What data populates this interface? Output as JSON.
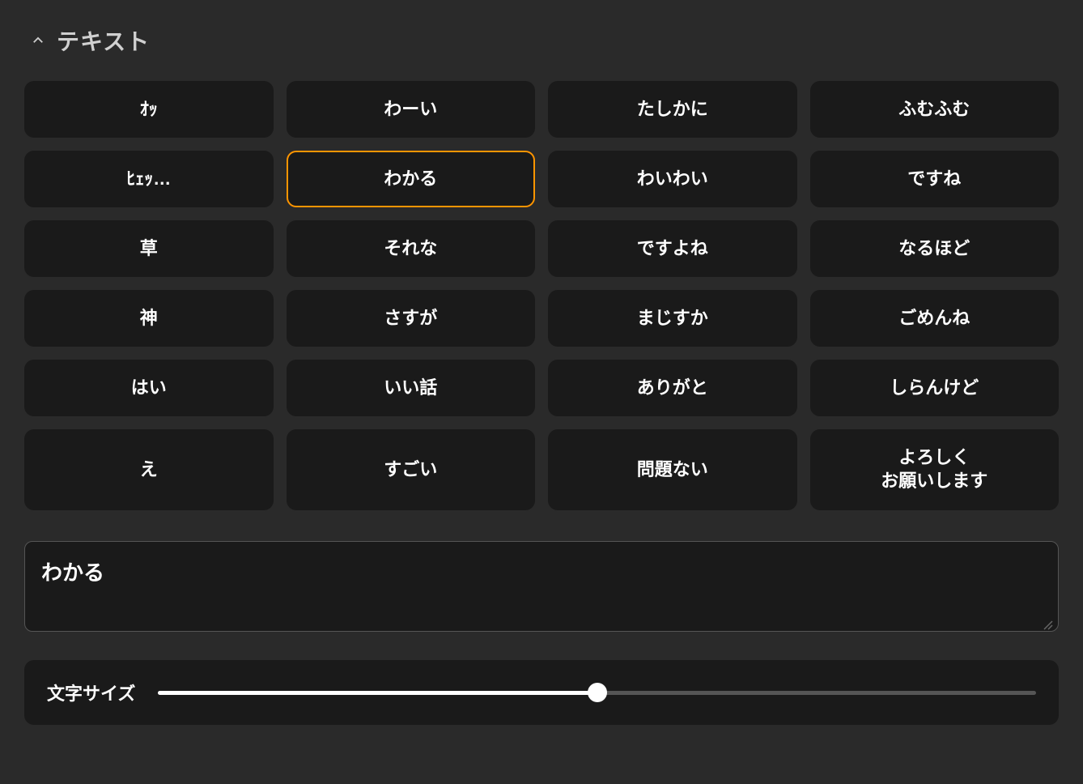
{
  "header": {
    "title": "テキスト"
  },
  "presets": [
    {
      "label": "ｵｯ",
      "selected": false
    },
    {
      "label": "わーい",
      "selected": false
    },
    {
      "label": "たしかに",
      "selected": false
    },
    {
      "label": "ふむふむ",
      "selected": false
    },
    {
      "label": "ﾋｪｯ…",
      "selected": false
    },
    {
      "label": "わかる",
      "selected": true
    },
    {
      "label": "わいわい",
      "selected": false
    },
    {
      "label": "ですね",
      "selected": false
    },
    {
      "label": "草",
      "selected": false
    },
    {
      "label": "それな",
      "selected": false
    },
    {
      "label": "ですよね",
      "selected": false
    },
    {
      "label": "なるほど",
      "selected": false
    },
    {
      "label": "神",
      "selected": false
    },
    {
      "label": "さすが",
      "selected": false
    },
    {
      "label": "まじすか",
      "selected": false
    },
    {
      "label": "ごめんね",
      "selected": false
    },
    {
      "label": "はい",
      "selected": false
    },
    {
      "label": "いい話",
      "selected": false
    },
    {
      "label": "ありがと",
      "selected": false
    },
    {
      "label": "しらんけど",
      "selected": false
    },
    {
      "label": "え",
      "selected": false,
      "tall": true
    },
    {
      "label": "すごい",
      "selected": false,
      "tall": true
    },
    {
      "label": "問題ない",
      "selected": false,
      "tall": true
    },
    {
      "label": "よろしく\nお願いします",
      "selected": false,
      "tall": true
    }
  ],
  "textarea": {
    "value": "わかる"
  },
  "slider": {
    "label": "文字サイズ",
    "value": 50
  }
}
